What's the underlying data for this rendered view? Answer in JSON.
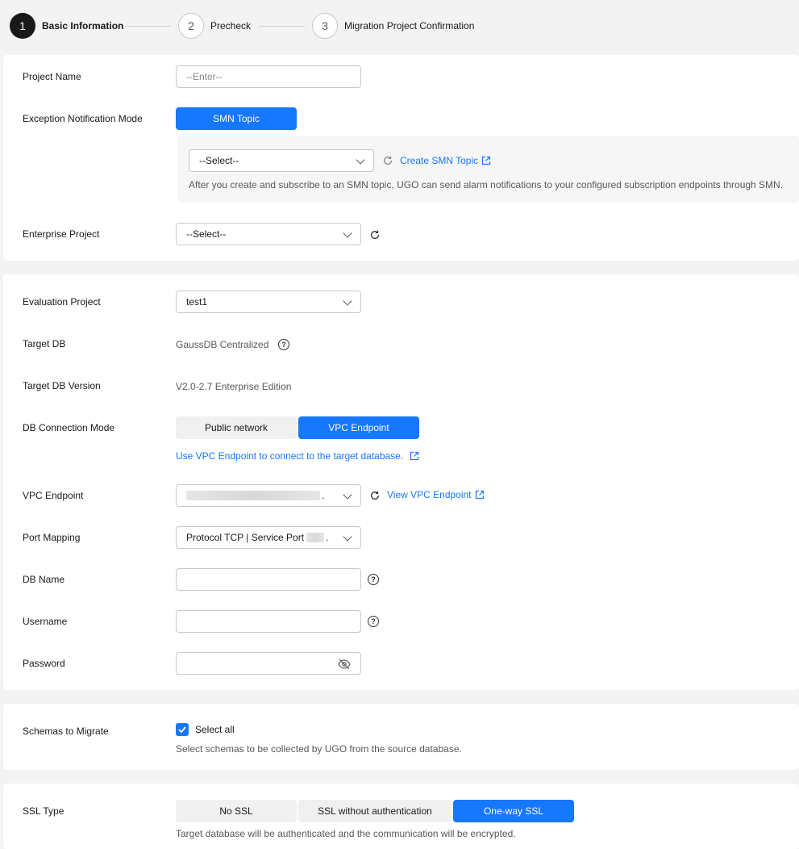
{
  "stepper": {
    "steps": [
      {
        "number": "1",
        "label": "Basic Information"
      },
      {
        "number": "2",
        "label": "Precheck"
      },
      {
        "number": "3",
        "label": "Migration Project Confirmation"
      }
    ]
  },
  "basic": {
    "project_name_label": "Project Name",
    "project_name_placeholder": "--Enter--",
    "exception_label": "Exception Notification Mode",
    "smn_button": "SMN Topic",
    "smn_select": "--Select--",
    "create_smn_link": "Create SMN Topic",
    "smn_hint": "After you create and subscribe to an SMN topic, UGO can send alarm notifications to your configured subscription endpoints through SMN.",
    "enterprise_label": "Enterprise Project",
    "enterprise_select": "--Select--"
  },
  "target": {
    "eval_label": "Evaluation Project",
    "eval_value": "test1",
    "target_db_label": "Target DB",
    "target_db_value": "GaussDB Centralized",
    "version_label": "Target DB Version",
    "version_value": "V2.0-2.7 Enterprise Edition",
    "conn_mode_label": "DB Connection Mode",
    "conn_public": "Public network",
    "conn_vpc": "VPC Endpoint",
    "vpc_hint_link": "Use VPC Endpoint to connect to the target database.",
    "vpc_label": "VPC Endpoint",
    "vpc_value_suffix": ".",
    "view_vpc_link": "View VPC Endpoint",
    "port_label": "Port Mapping",
    "port_value": "Protocol TCP | Service Port",
    "port_value_suffix": ".",
    "dbname_label": "DB Name",
    "username_label": "Username",
    "password_label": "Password"
  },
  "schemas": {
    "label": "Schemas to Migrate",
    "select_all": "Select all",
    "hint": "Select schemas to be collected by UGO from the source database."
  },
  "ssl": {
    "label": "SSL Type",
    "no_ssl": "No SSL",
    "without_auth": "SSL without authentication",
    "one_way": "One-way SSL",
    "hint": "Target database will be authenticated and the communication will be encrypted."
  },
  "colors": {
    "accent": "#1677ff",
    "active_step": "#191919"
  }
}
